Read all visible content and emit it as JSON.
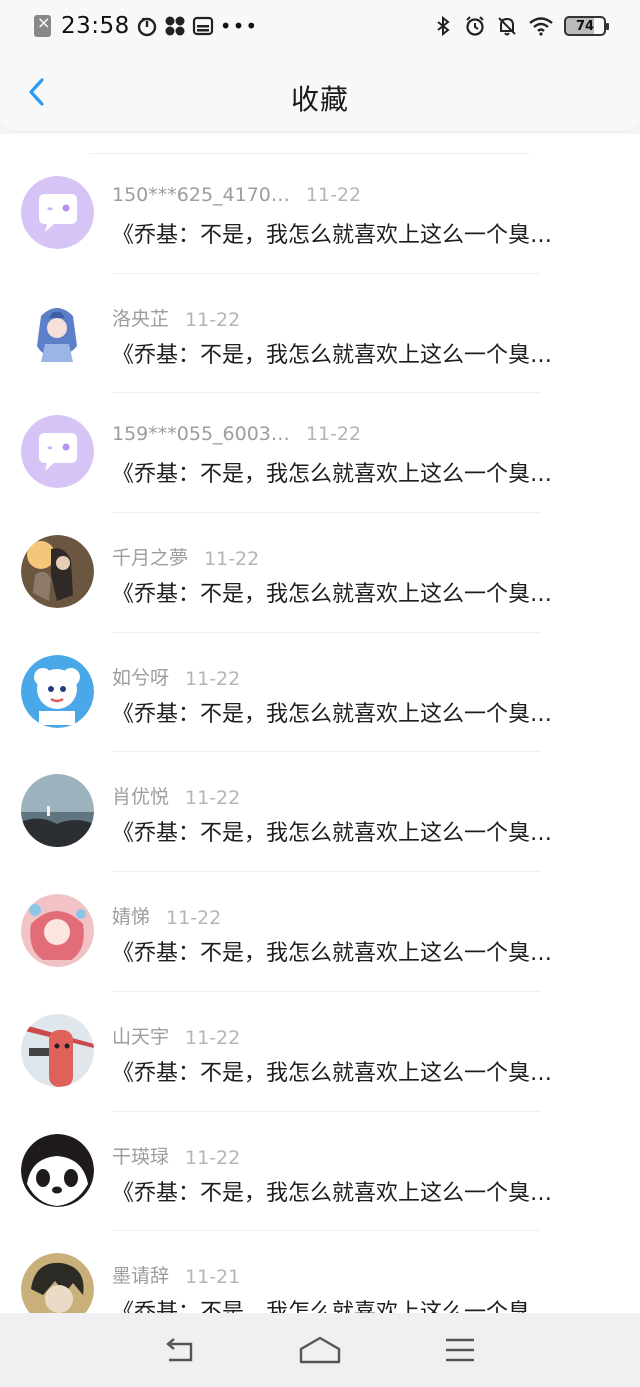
{
  "status_bar": {
    "time": "23:58",
    "battery": "74",
    "icons": [
      "app-icon",
      "timer-icon",
      "fan-icon",
      "sim-icon",
      "bluetooth-icon",
      "alarm-icon",
      "mute-icon",
      "wifi-icon",
      "battery-icon"
    ]
  },
  "header": {
    "title": "收藏",
    "back_icon": "chevron-left-icon"
  },
  "favorites": [
    {
      "name": "150***625_4170…",
      "date": "11-22",
      "content": "《乔基：不是，我怎么就喜欢上这么一个臭…",
      "avatar": "chat-bubble-avatar"
    },
    {
      "name": "洛央芷",
      "date": "11-22",
      "content": "《乔基：不是，我怎么就喜欢上这么一个臭…",
      "avatar": "anime-girl-avatar"
    },
    {
      "name": "159***055_6003…",
      "date": "11-22",
      "content": "《乔基：不是，我怎么就喜欢上这么一个臭…",
      "avatar": "chat-bubble-avatar"
    },
    {
      "name": "千月之夢",
      "date": "11-22",
      "content": "《乔基：不是，我怎么就喜欢上这么一个臭…",
      "avatar": "anime-couple-avatar"
    },
    {
      "name": "如兮呀",
      "date": "11-22",
      "content": "《乔基：不是，我怎么就喜欢上这么一个臭…",
      "avatar": "cartoon-sheep-avatar"
    },
    {
      "name": "肖优悦",
      "date": "11-22",
      "content": "《乔基：不是，我怎么就喜欢上这么一个臭…",
      "avatar": "seaside-avatar"
    },
    {
      "name": "婧悌",
      "date": "11-22",
      "content": "《乔基：不是，我怎么就喜欢上这么一个臭…",
      "avatar": "pink-anime-avatar"
    },
    {
      "name": "山天宇",
      "date": "11-22",
      "content": "《乔基：不是，我怎么就喜欢上这么一个臭…",
      "avatar": "cartoon-finger-avatar"
    },
    {
      "name": "干瑛琭",
      "date": "11-22",
      "content": "《乔基：不是，我怎么就喜欢上这么一个臭…",
      "avatar": "panda-avatar"
    },
    {
      "name": "墨请辞",
      "date": "11-21",
      "content": "《乔基：不是，我怎么就喜欢上这么一个臭…",
      "avatar": "anime-boy-avatar"
    }
  ],
  "navigation": {
    "buttons": [
      "back-icon",
      "home-icon",
      "menu-icon"
    ]
  }
}
